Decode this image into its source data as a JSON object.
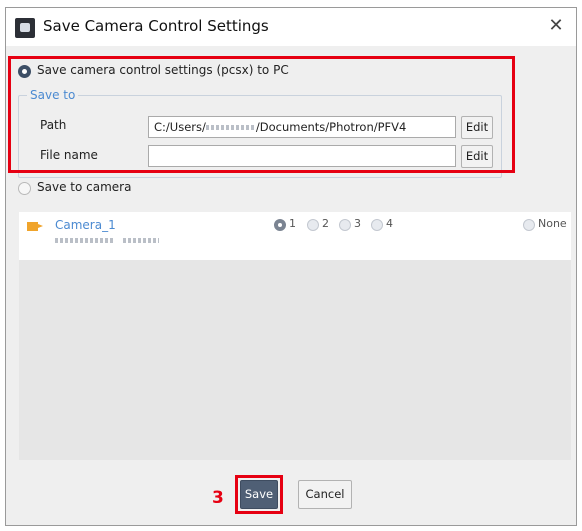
{
  "window": {
    "title": "Save Camera Control Settings",
    "icon": "app-camera-icon",
    "close_icon": "close-icon"
  },
  "save_to_pc": {
    "radio_label": "Save camera control settings (pcsx) to PC",
    "selected": true,
    "group_legend": "Save to",
    "path_label": "Path",
    "path_value_prefix": "C:/Users/",
    "path_value_suffix": "/Documents/Photron/PFV4",
    "path_edit": "Edit",
    "filename_label": "File name",
    "filename_value": "",
    "filename_edit": "Edit"
  },
  "save_to_camera": {
    "radio_label": "Save to camera",
    "selected": false,
    "cameras": [
      {
        "name": "Camera_1",
        "slot_options": [
          "1",
          "2",
          "3",
          "4"
        ],
        "selected_slot": "1",
        "none_label": "None"
      }
    ]
  },
  "footer": {
    "step_marker": "3",
    "save_label": "Save",
    "cancel_label": "Cancel"
  },
  "colors": {
    "highlight": "#e60012",
    "legend": "#4b8ad1",
    "camera_name": "#4b8ad1",
    "camera_icon": "#f0a42b",
    "save_button": "#4f5f75"
  }
}
